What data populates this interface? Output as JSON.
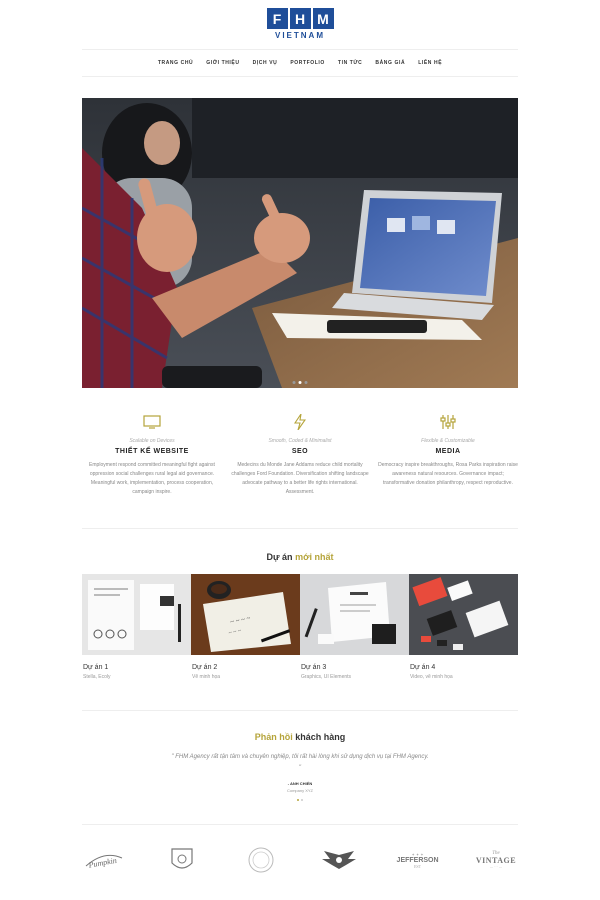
{
  "logo": {
    "letters": [
      "F",
      "H",
      "M"
    ],
    "sub": "VIETNAM"
  },
  "nav": [
    "TRANG CHỦ",
    "GIỚI THIỆU",
    "DỊCH VỤ",
    "PORTFOLIO",
    "TIN TỨC",
    "BẢNG GIÁ",
    "LIÊN HỆ"
  ],
  "hero": {
    "slides": 3,
    "active_slide": 2
  },
  "services": [
    {
      "icon": "monitor-icon",
      "sub": "Scalable on Devices",
      "title": "THIẾT KẾ WEBSITE",
      "desc": "Employment respond committed meaningful fight against oppression social challenges rural legal aid governance. Meaningful work, implementation, process cooperation, campaign inspire."
    },
    {
      "icon": "lightning-icon",
      "sub": "Smooth, Coded & Minimalist",
      "title": "SEO",
      "desc": "Medecins du Monde Jane Addams reduce child mortality challenges Ford Foundation. Diversification shifting landscape advocate pathway to a better life rights international. Assessment."
    },
    {
      "icon": "sliders-icon",
      "sub": "Flexible & Customizable",
      "title": "MEDIA",
      "desc": "Democracy inspire breakthroughs, Rosa Parks inspiration raise awareness natural resources. Governance impact; transformative donation philanthropy, respect reproductive."
    }
  ],
  "projects_title": {
    "pre": "Dự án ",
    "hl": "mới nhất"
  },
  "projects": [
    {
      "name": "Dự án 1",
      "cat": "Stella, Ecoly"
    },
    {
      "name": "Dự án 2",
      "cat": "Vẽ minh họa"
    },
    {
      "name": "Dự án 3",
      "cat": "Graphics, UI Elements"
    },
    {
      "name": "Dự án 4",
      "cat": "Video, vẽ minh họa"
    }
  ],
  "feedback_title": {
    "hl": "Phản hồi",
    "post": " khách hàng"
  },
  "testimonial": {
    "quote": "\" FHM Agency rất tận tâm và chuyên nghiệp, tôi rất hài lòng khi sử dụng dịch vụ tại FHM Agency. \"",
    "author": "- ANH CHIẾN",
    "role": "Company XYZ"
  },
  "clients": [
    "Pumpkinhead",
    "Badge",
    "Circle",
    "Wings",
    "JEFFERSON",
    "The VINTAGE"
  ],
  "colors": {
    "brand": "#1f4e99",
    "accent": "#b5a43a"
  }
}
